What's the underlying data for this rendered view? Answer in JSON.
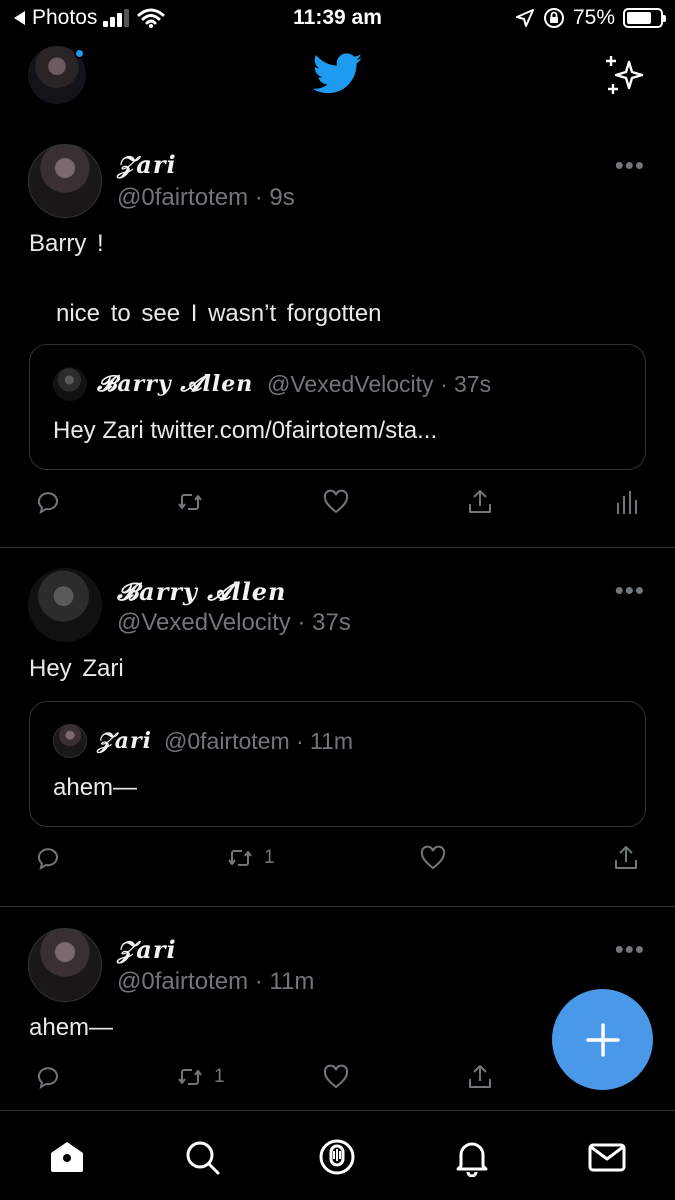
{
  "status_bar": {
    "back_label": "Photos",
    "time": "11:39 am",
    "battery_percent": "75%",
    "battery_level": 0.75
  },
  "header": {
    "logo_icon": "twitter-bird-icon",
    "sparkle_icon": "sparkle-icon",
    "accent": "#1d9bf0"
  },
  "tweets": [
    {
      "name": "𝒵ari",
      "handle": "@0fairtotem",
      "time": "· 9s",
      "more": "•••",
      "text_line1": "Barry !",
      "text_line2": "nice to see I wasn’t forgotten",
      "quote": {
        "name": "𝓑arry 𝓐llen",
        "handle": "@VexedVelocity · 37s",
        "text": "Hey Zari twitter.com/0fairtotem/sta..."
      },
      "retweet_count": "",
      "like_count": ""
    },
    {
      "name": "𝓑arry 𝓐llen",
      "handle": "@VexedVelocity",
      "time": "· 37s",
      "more": "•••",
      "text_line1": "Hey Zari",
      "quote": {
        "name": "𝒵ari",
        "handle": "@0fairtotem · 11m",
        "text": "ahem—"
      },
      "retweet_count": "1"
    },
    {
      "name": "𝒵ari",
      "handle": "@0fairtotem",
      "time": "· 11m",
      "more": "•••",
      "text_line1": "ahem—",
      "retweet_count": "1"
    }
  ],
  "tabs": [
    "home-icon",
    "search-icon",
    "spaces-icon",
    "notifications-icon",
    "messages-icon"
  ]
}
